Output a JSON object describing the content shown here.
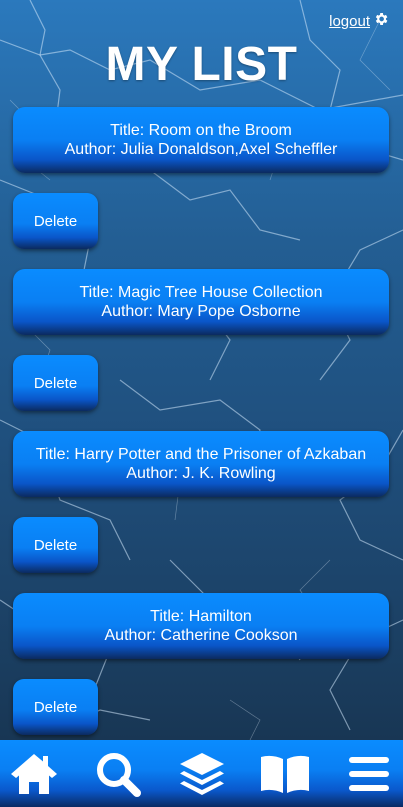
{
  "header": {
    "logout_label": "logout",
    "title": "MY LIST"
  },
  "books": [
    {
      "title_text": "Title: Room on the Broom",
      "author_text": "Author: Julia Donaldson,Axel Scheffler",
      "delete_label": "Delete"
    },
    {
      "title_text": "Title: Magic Tree House Collection",
      "author_text": "Author: Mary Pope Osborne",
      "delete_label": "Delete"
    },
    {
      "title_text": "Title: Harry Potter and the Prisoner of Azkaban",
      "author_text": "Author: J. K. Rowling",
      "delete_label": "Delete"
    },
    {
      "title_text": "Title: Hamilton",
      "author_text": "Author: Catherine Cookson",
      "delete_label": "Delete"
    }
  ],
  "nav": {
    "items": [
      "home-icon",
      "search-icon",
      "layers-icon",
      "book-icon",
      "menu-icon"
    ]
  },
  "colors": {
    "accent": "#0a8cff",
    "background": "#1f4f7d"
  }
}
